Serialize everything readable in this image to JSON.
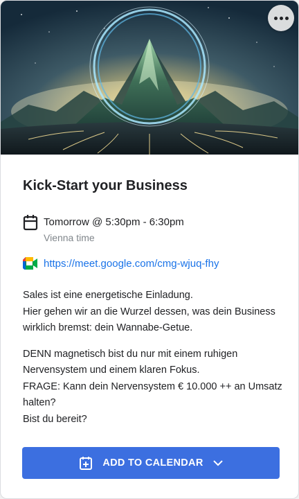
{
  "hero": {
    "image_alt": "Glowing mountain inside a luminous ring"
  },
  "menu": {
    "icon": "more-horiz-icon"
  },
  "event": {
    "title": "Kick-Start your Business",
    "time": "Tomorrow @ 5:30pm - 6:30pm",
    "timezone": "Vienna time",
    "meet_link": "https://meet.google.com/cmg-wjuq-fhy"
  },
  "description": {
    "paragraph1": "Sales ist eine energetische Einladung.\nHier gehen wir an die Wurzel dessen, was dein Business wirklich bremst: dein Wannabe-Getue.",
    "paragraph2": "DENN magnetisch bist du nur mit einem ruhigen Nervensystem und einem klaren Fokus.\nFRAGE: Kann dein Nervensystem € 10.000 ++ an Umsatz halten?\nBist du bereit?"
  },
  "add_button": {
    "label": "ADD TO CALENDAR"
  },
  "colors": {
    "primary": "#3c6fe0",
    "link": "#1a73e8",
    "muted": "#80868b"
  }
}
